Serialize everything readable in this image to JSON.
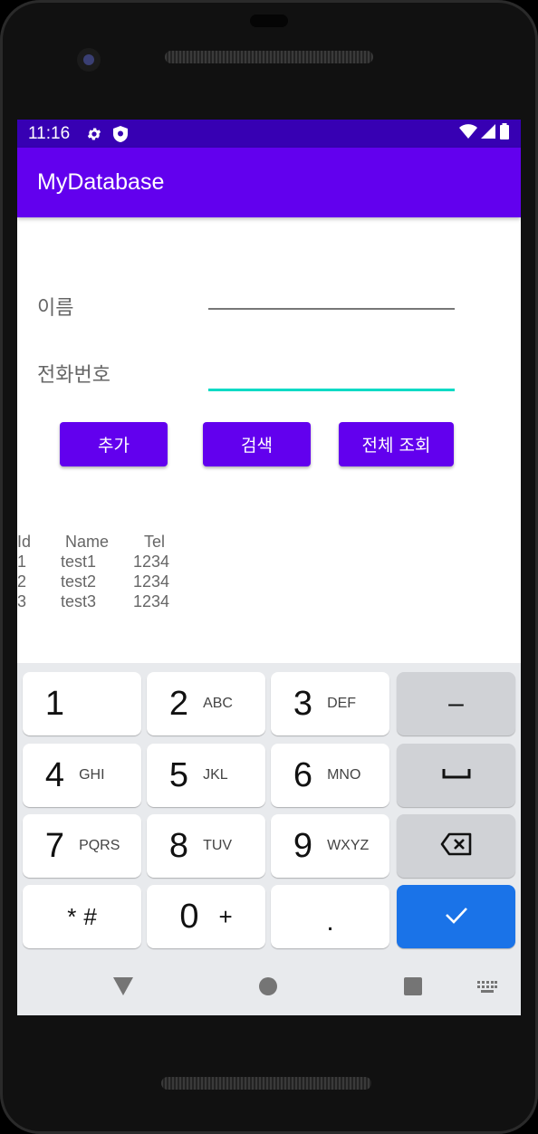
{
  "status_bar": {
    "time": "11:16"
  },
  "app_bar": {
    "title": "MyDatabase"
  },
  "form": {
    "name_label": "이름",
    "name_value": "",
    "tel_label": "전화번호",
    "tel_value": ""
  },
  "buttons": {
    "add": "추가",
    "search": "검색",
    "view_all": "전체 조회"
  },
  "table": {
    "headers": {
      "id": "Id",
      "name": "Name",
      "tel": "Tel"
    },
    "rows": [
      {
        "id": "1",
        "name": "test1",
        "tel": "1234"
      },
      {
        "id": "2",
        "name": "test2",
        "tel": "1234"
      },
      {
        "id": "3",
        "name": "test3",
        "tel": "1234"
      }
    ]
  },
  "keyboard": {
    "keys": [
      {
        "main": "1",
        "sub": ""
      },
      {
        "main": "2",
        "sub": "ABC"
      },
      {
        "main": "3",
        "sub": "DEF"
      },
      {
        "main": "4",
        "sub": "GHI"
      },
      {
        "main": "5",
        "sub": "JKL"
      },
      {
        "main": "6",
        "sub": "MNO"
      },
      {
        "main": "7",
        "sub": "PQRS"
      },
      {
        "main": "8",
        "sub": "TUV"
      },
      {
        "main": "9",
        "sub": "WXYZ"
      },
      {
        "main": "*",
        "sub": "#"
      },
      {
        "main": "0",
        "sub": "+"
      },
      {
        "main": ".",
        "sub": ""
      }
    ],
    "minus": "–"
  },
  "colors": {
    "primary": "#6200ee",
    "primary_dark": "#3700b3",
    "accent": "#03dac5",
    "action_key": "#1a73e8"
  }
}
